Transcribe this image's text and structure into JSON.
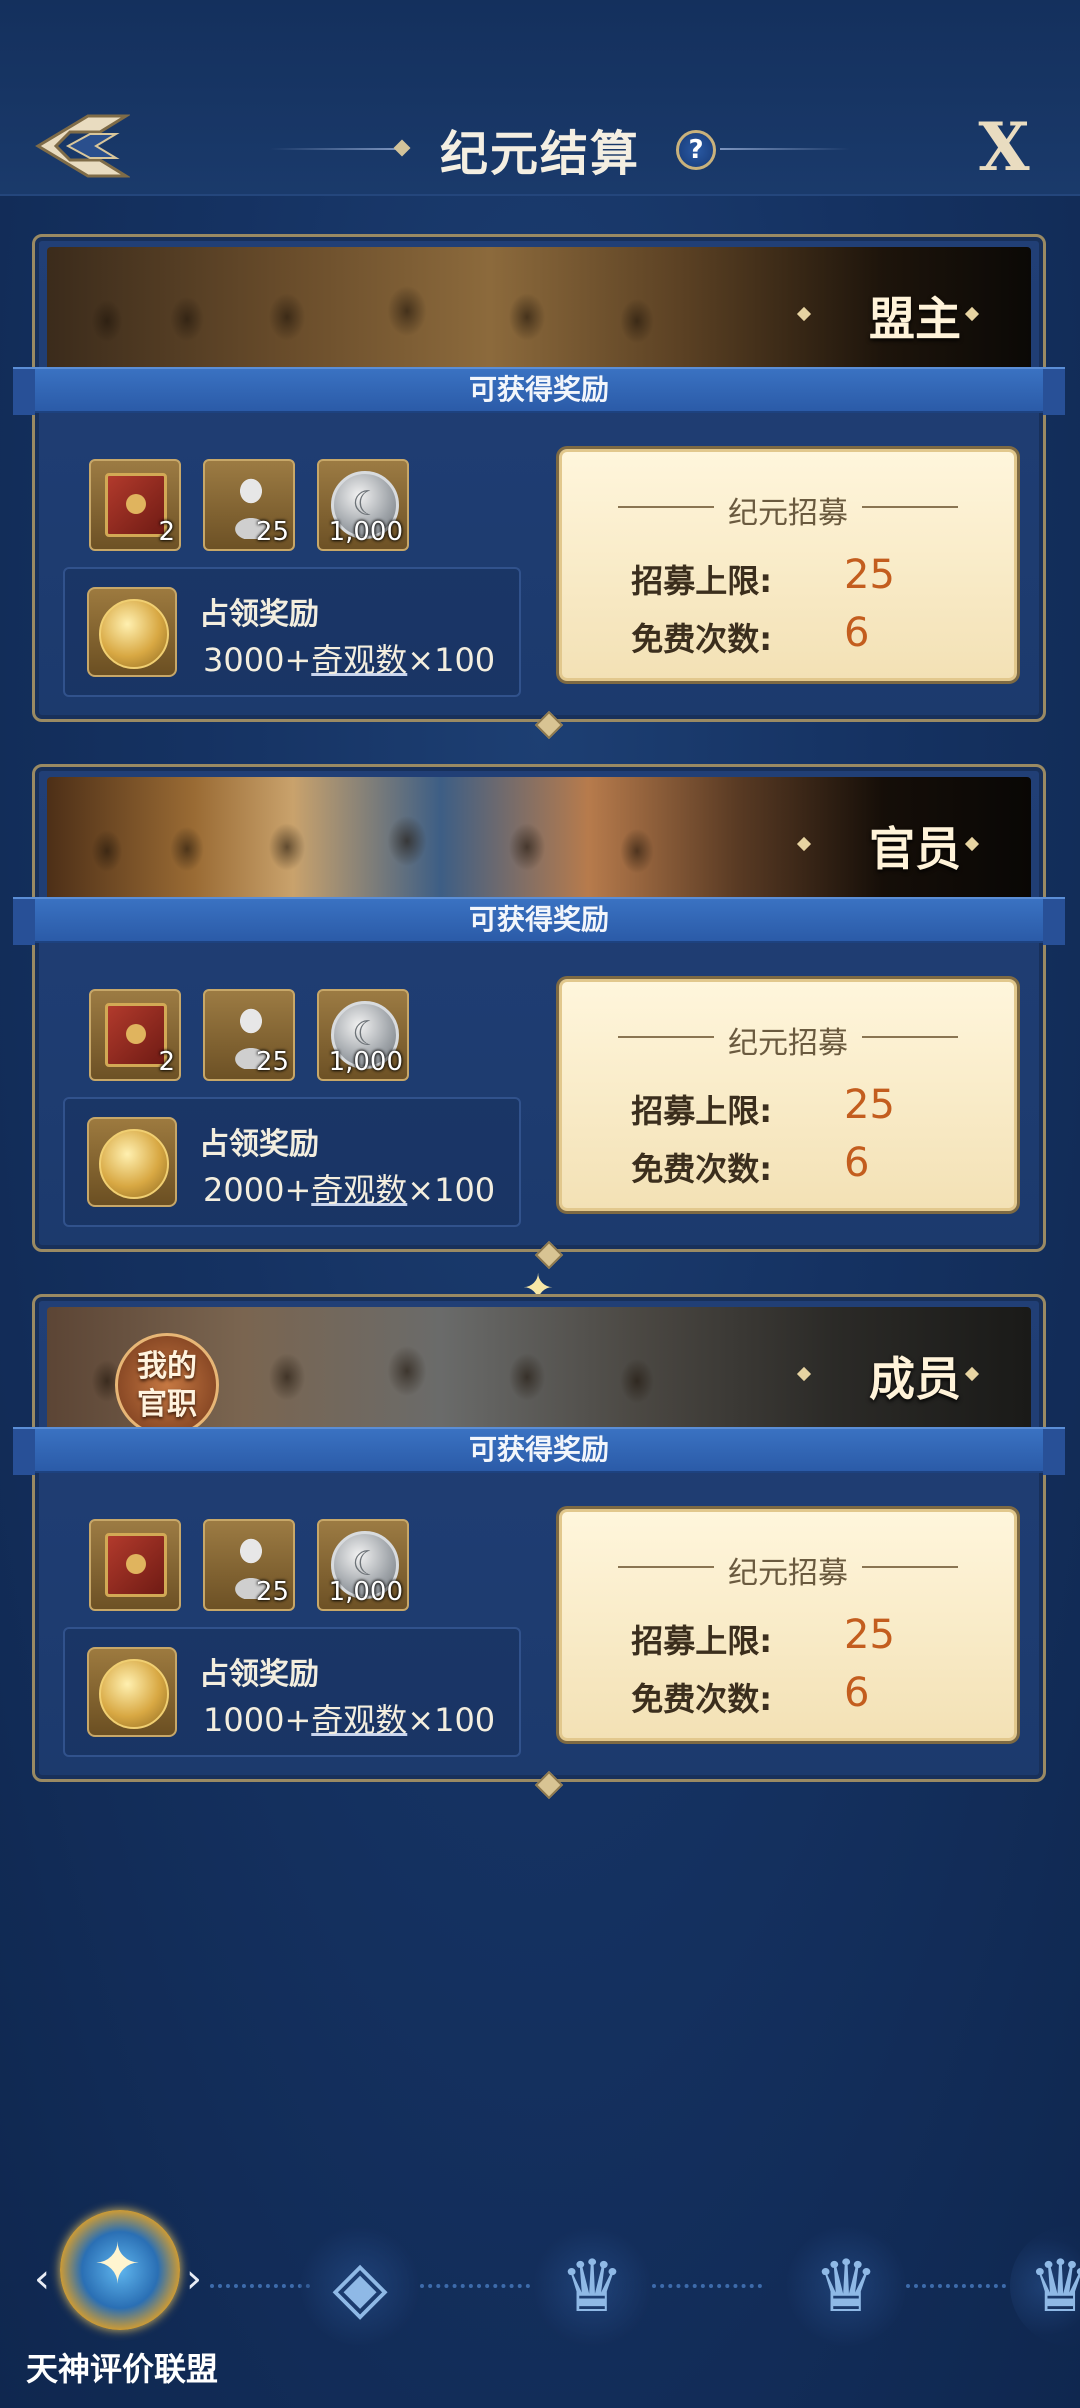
{
  "header": {
    "title": "纪元结算",
    "help_icon": "?",
    "close_label": "X"
  },
  "colors": {
    "accent_gold": "#c7a768",
    "value_orange": "#c35d1e",
    "ribbon_blue": "#2b5ba8",
    "background": "#153262"
  },
  "reward_header": "可获得奖励",
  "recruit_title": "纪元招募",
  "recruit_limit_label": "招募上限:",
  "free_times_label": "免费次数:",
  "occupy_label": "占领奖励",
  "occupy_link": "奇观数",
  "cards": [
    {
      "rank": "盟主",
      "items": [
        {
          "icon": "red-book-icon",
          "qty": "2"
        },
        {
          "icon": "marble-bust-icon",
          "qty": "25"
        },
        {
          "icon": "silver-coin-icon",
          "qty": "1,000"
        }
      ],
      "occupy_prefix": "3000+",
      "occupy_suffix": "×100",
      "recruit_limit": "25",
      "free_times": "6"
    },
    {
      "rank": "官员",
      "items": [
        {
          "icon": "red-book-icon",
          "qty": "2"
        },
        {
          "icon": "marble-bust-icon",
          "qty": "25"
        },
        {
          "icon": "silver-coin-icon",
          "qty": "1,000"
        }
      ],
      "occupy_prefix": "2000+",
      "occupy_suffix": "×100",
      "recruit_limit": "25",
      "free_times": "6"
    },
    {
      "rank": "成员",
      "my_rank_badge": "我的\n官职",
      "items": [
        {
          "icon": "red-book-icon",
          "qty": ""
        },
        {
          "icon": "marble-bust-icon",
          "qty": "25"
        },
        {
          "icon": "silver-coin-icon",
          "qty": "1,000"
        }
      ],
      "occupy_prefix": "1000+",
      "occupy_suffix": "×100",
      "recruit_limit": "25",
      "free_times": "6"
    }
  ],
  "bottom": {
    "league_label": "天神评价联盟",
    "prev_arrow": "‹",
    "next_arrow": "›",
    "tiers": [
      "diamond-wings-icon",
      "crown-icon",
      "crown-large-icon",
      "crown-partial-icon"
    ]
  }
}
